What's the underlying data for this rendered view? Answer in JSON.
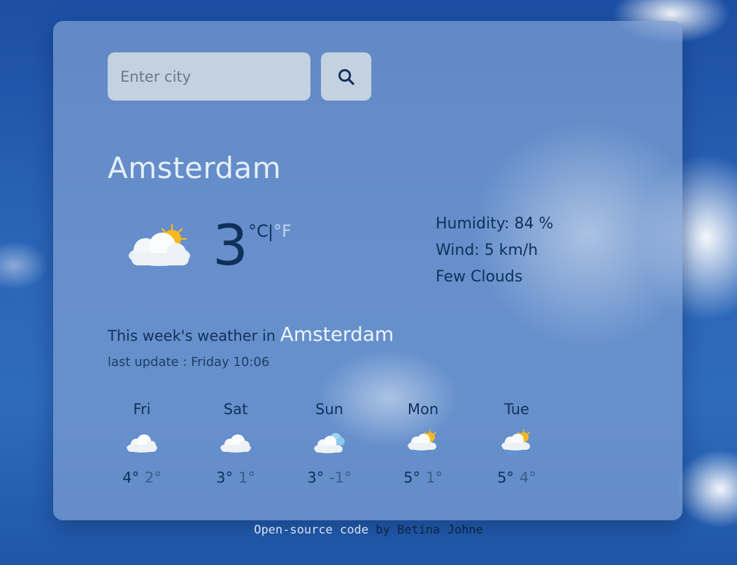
{
  "search": {
    "placeholder": "Enter city",
    "value": ""
  },
  "current": {
    "city": "Amsterdam",
    "icon": "sun-behind-cloud-icon",
    "temperature": "3",
    "unit_celsius": "°C",
    "unit_separator": "|",
    "unit_fahrenheit": "°F",
    "humidity": "Humidity: 84 %",
    "wind": "Wind: 5 km/h",
    "description": "Few Clouds"
  },
  "week": {
    "heading_prefix": "This week's weather in",
    "city": "Amsterdam",
    "last_update": "last update : Friday 10:06",
    "days": [
      {
        "day": "Fri",
        "icon": "cloud-icon",
        "max": "4°",
        "min": "2°"
      },
      {
        "day": "Sat",
        "icon": "cloud-icon",
        "max": "3°",
        "min": "1°"
      },
      {
        "day": "Sun",
        "icon": "snow-cloud-icon",
        "max": "3°",
        "min": "-1°"
      },
      {
        "day": "Mon",
        "icon": "sun-rain-cloud-icon",
        "max": "5°",
        "min": "1°"
      },
      {
        "day": "Tue",
        "icon": "sun-rain-cloud-icon",
        "max": "5°",
        "min": "4°"
      }
    ]
  },
  "footer": {
    "link_text": "Open-source code",
    "by": "by",
    "author": "Betina Johne"
  },
  "colors": {
    "accent_dark": "#10305a",
    "accent_light": "#e6eef8",
    "card_bg": "#7da0d2",
    "input_bg": "#c4d1e1",
    "sun": "#f5b920"
  }
}
